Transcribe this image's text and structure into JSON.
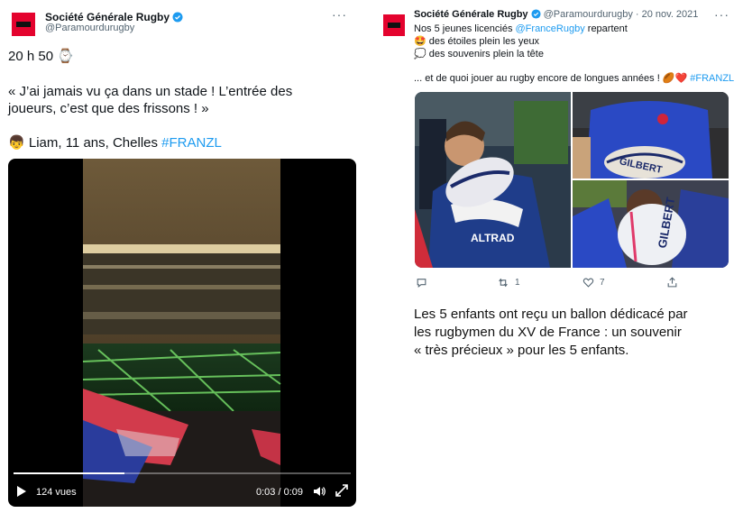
{
  "left_tweet": {
    "account_name": "Société Générale Rugby",
    "handle": "@Paramourdurugby",
    "line1": "20 h 50",
    "watch_emoji": "⌚",
    "quote_line1": "« J’ai jamais vu ça dans un stade ! L’entrée des",
    "quote_line2": "joueurs, c’est que des frissons ! »",
    "kid_emoji": "👦",
    "kid_text": "Liam, 11 ans, Chelles",
    "hashtag": "#FRANZL",
    "video": {
      "views": "124 vues",
      "time": "0:03 / 0:09",
      "progress": 0.33
    }
  },
  "right_tweet": {
    "account_name": "Société Générale Rugby",
    "handle": "@Paramourdurugby",
    "date": "· 20 nov. 2021",
    "line1_pre": "Nos 5 jeunes licenciés",
    "line1_mention": "@FranceRugby",
    "line1_post": "repartent",
    "line2_emoji": "🤩",
    "line2": "des étoiles plein les yeux",
    "line3_emoji": "💭",
    "line3": "des souvenirs plein la tête",
    "line4": "... et de quoi jouer au rugby encore de longues années !",
    "line4_emojis": "🏉❤️",
    "hashtag": "#FRANZL",
    "photo_texts": {
      "shirt": "ALTRAD",
      "ball": "GILBERT"
    },
    "actions": {
      "retweets": "1",
      "likes": "7"
    }
  },
  "caption": {
    "line1": "Les 5 enfants ont reçu un ballon dédicacé par",
    "line2": "les rugbymen du XV de France : un souvenir",
    "line3": "« très précieux » pour les 5 enfants."
  },
  "colors": {
    "brand_red": "#e4032e",
    "link_blue": "#1d9bf0",
    "muted": "#536471"
  }
}
